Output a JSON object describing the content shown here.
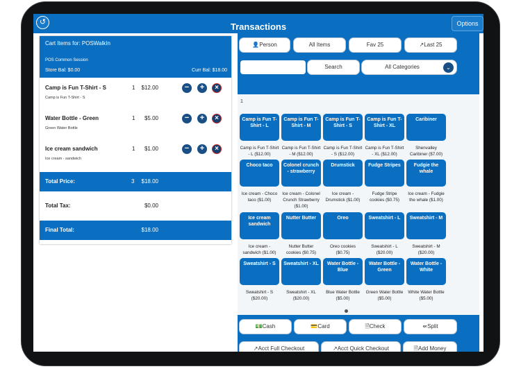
{
  "header": {
    "title": "Transactions",
    "back_icon": "back-arrow-icon",
    "options_label": "Options"
  },
  "cart": {
    "heading": "Cart Items for: POSWalkIn",
    "session": "POS Common Session",
    "store_bal": "Store Bal: $0.00",
    "curr_bal": "Curr Bal: $18.00",
    "items": [
      {
        "name": "Camp is Fun T-Shirt - S",
        "desc": "Camp is Fun T-Shirt - S",
        "qty": "1",
        "price": "$12.00"
      },
      {
        "name": "Water Bottle - Green",
        "desc": "Green Water Bottle",
        "qty": "1",
        "price": "$5.00"
      },
      {
        "name": "Ice cream sandwich",
        "desc": "Ice cream - sandwich",
        "qty": "1",
        "price": "$1.00"
      }
    ],
    "total_price": {
      "label": "Total Price:",
      "qty": "3",
      "value": "$18.00"
    },
    "total_tax": {
      "label": "Total Tax:",
      "value": "$0.00"
    },
    "final_total": {
      "label": "Final Total:",
      "value": "$18.00"
    }
  },
  "filters": {
    "person": "Person",
    "all_items": "All Items",
    "fav": "Fav 25",
    "last": "Last 25"
  },
  "search": {
    "button": "Search",
    "placeholder": "",
    "category": "All Categories"
  },
  "page_number": "1",
  "products": [
    {
      "btn": "Camp is Fun T-Shirt - L",
      "label": "Camp is Fun T-Shirt - L ($12.00)"
    },
    {
      "btn": "Camp is Fun T-Shirt - M",
      "label": "Camp is Fun T-Shirt - M ($12.00)"
    },
    {
      "btn": "Camp is Fun T-Shirt - S",
      "label": "Camp is Fun T-Shirt - S ($12.00)"
    },
    {
      "btn": "Camp is Fun T-Shirt - XL",
      "label": "Camp is Fun T-Shirt - XL ($12.00)"
    },
    {
      "btn": "Caribiner",
      "label": "Shenvalley Caribiner ($7.00)"
    },
    {
      "btn": "Choco taco",
      "label": "Ice cream - Choco taco ($1.00)"
    },
    {
      "btn": "Colonel crunch - strawberry",
      "label": "Ice cream - Colonel Crunch Strawberry ($1.00)"
    },
    {
      "btn": "Drumstick",
      "label": "Ice cream - Drumstick ($1.00)"
    },
    {
      "btn": "Fudge Stripes",
      "label": "Fudge Stripe cookies ($0.75)"
    },
    {
      "btn": "Fudgie the whale",
      "label": "Ice cream - Fudgie the whale ($1.00)"
    },
    {
      "btn": "Ice cream sandwich",
      "label": "Ice cream - sandwich ($1.00)"
    },
    {
      "btn": "Nutter Butter",
      "label": "Nutter Butter cookies ($0.75)"
    },
    {
      "btn": "Oreo",
      "label": "Oreo cookies ($0.75)"
    },
    {
      "btn": "Sweatshirt - L",
      "label": "Sweatshirt - L ($20.00)"
    },
    {
      "btn": "Sweatshirt - M",
      "label": "Sweatshirt - M ($20.00)"
    },
    {
      "btn": "Sweatshirt - S",
      "label": "Sweatshirt - S ($20.00)"
    },
    {
      "btn": "Sweatshirt - XL",
      "label": "Sweatshirt - XL ($20.00)"
    },
    {
      "btn": "Water Bottle - Blue",
      "label": "Blue Water Bottle ($5.00)"
    },
    {
      "btn": "Water Bottle - Green",
      "label": "Green Water Bottle ($5.00)"
    },
    {
      "btn": "Water Bottle - White",
      "label": "White Water Bottle ($5.00)"
    }
  ],
  "payment": {
    "cash": "Cash",
    "card": "Card",
    "check": "Check",
    "split": "Split",
    "acct_full": "Acct Full Checkout",
    "acct_quick": "Acct Quick Checkout",
    "add_money": "Add Money"
  },
  "colors": {
    "accent": "#0a6fc0",
    "dark_icon": "#1a4f86",
    "remove_ring": "#c62828"
  }
}
